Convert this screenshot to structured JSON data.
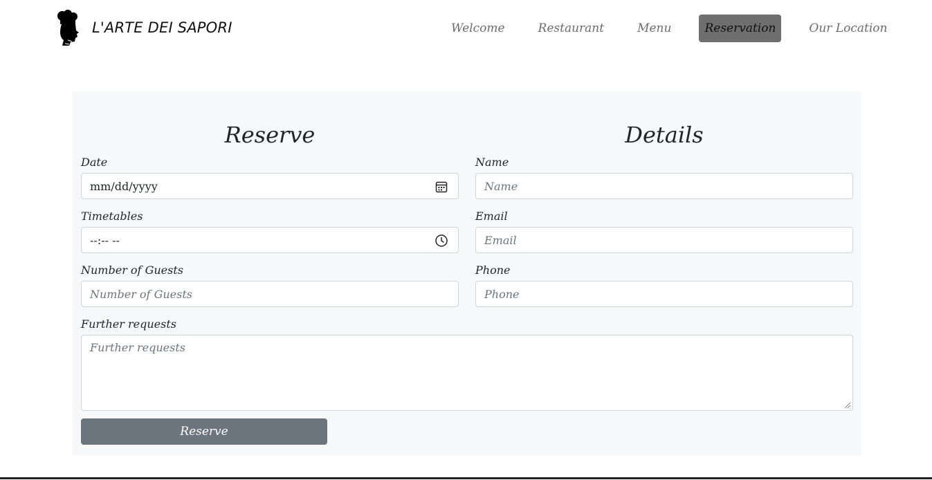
{
  "brand": {
    "name": "L'ARTE DEI SAPORI",
    "logo_icon": "chef-head-icon"
  },
  "nav": {
    "items": [
      {
        "label": "Welcome",
        "active": false
      },
      {
        "label": "Restaurant",
        "active": false
      },
      {
        "label": "Menu",
        "active": false
      },
      {
        "label": "Reservation",
        "active": true
      },
      {
        "label": "Our Location",
        "active": false
      }
    ],
    "active_bg": "#6e6e6e"
  },
  "form": {
    "reserve_title": "Reserve",
    "details_title": "Details",
    "date": {
      "label": "Date",
      "value": "mm/dd/yyyy",
      "icon": "calendar-icon"
    },
    "time": {
      "label": "Timetables",
      "value": "--:-- --",
      "icon": "clock-icon"
    },
    "guests": {
      "label": "Number of Guests",
      "placeholder": "Number of Guests"
    },
    "name": {
      "label": "Name",
      "placeholder": "Name"
    },
    "email": {
      "label": "Email",
      "placeholder": "Email"
    },
    "phone": {
      "label": "Phone",
      "placeholder": "Phone"
    },
    "requests": {
      "label": "Further requests",
      "placeholder": "Further requests"
    },
    "submit_label": "Reserve"
  },
  "colors": {
    "panel_bg": "#f7f8fa",
    "button_bg": "#6c757d",
    "input_border": "#ced4da"
  }
}
